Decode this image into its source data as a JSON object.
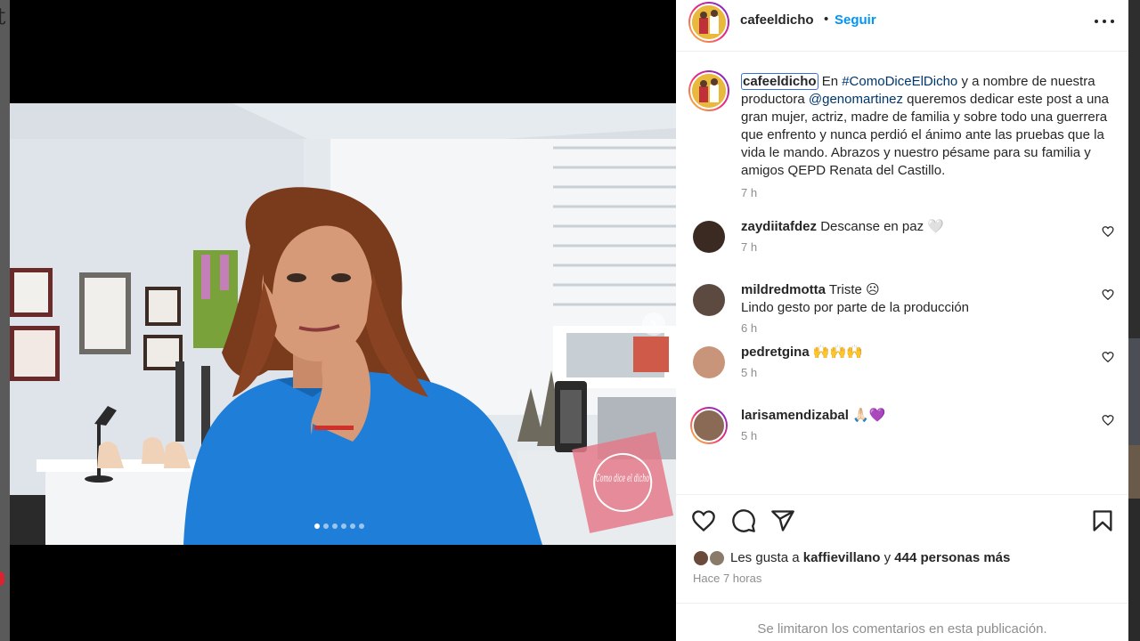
{
  "background_page": {
    "left_glyph": "t"
  },
  "post": {
    "author": "cafeeldicho",
    "separator": "•",
    "follow_label": "Seguir",
    "caption_user": "cafeeldicho",
    "caption_part1": " En ",
    "caption_hashtag": "#ComoDiceElDicho",
    "caption_part2": " y a nombre de nuestra productora ",
    "caption_mention": "@genomartinez",
    "caption_part3": " queremos dedicar este post a una gran mujer, actriz, madre de familia y sobre todo una guerrera que enfrento y nunca perdió el ánimo ante las pruebas que la vida le mando. Abrazos y nuestro pésame para su familia y amigos QEPD Renata del Castillo.",
    "caption_time": "7 h",
    "carousel": {
      "count": 6,
      "active_index": 0
    },
    "watermark_text": "Como dice el dicho"
  },
  "comments": [
    {
      "user": "zaydiitafdez",
      "text": "Descanse en paz 🤍",
      "time": "7 h",
      "avatar_color": "#3a2a22",
      "story_ring": false
    },
    {
      "user": "mildredmotta",
      "text": "Triste ☹\nLindo gesto por parte de la producción",
      "time": "6 h",
      "avatar_color": "#5c4a40",
      "story_ring": false
    },
    {
      "user": "pedretgina",
      "text": "🙌🙌🙌",
      "time": "5 h",
      "avatar_color": "#c9957a",
      "story_ring": false
    },
    {
      "user": "larisamendizabal",
      "text": "🙏🏻💜",
      "time": "5 h",
      "avatar_color": "#8a6a55",
      "story_ring": true
    }
  ],
  "likes": {
    "prefix": "Les gusta a ",
    "first_user": "kaffievillano",
    "middle": " y ",
    "others": "444 personas más"
  },
  "post_time": "Hace 7 horas",
  "footer_note": "Se limitaron los comentarios en esta publicación.",
  "colors": {
    "link": "#00376b",
    "follow": "#0095f6",
    "muted": "#8e8e8e",
    "text": "#262626",
    "shirt": "#1f7fd8",
    "hair": "#7a3a1c"
  },
  "icons": [
    "heart-icon",
    "comment-icon",
    "share-icon",
    "bookmark-icon",
    "more-options-icon",
    "chevron-right-icon"
  ]
}
